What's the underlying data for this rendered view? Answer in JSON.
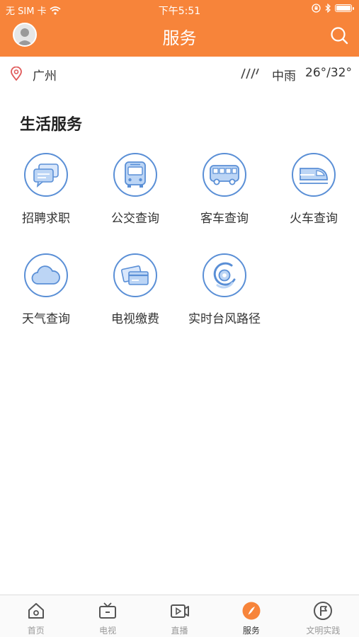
{
  "status_bar": {
    "carrier": "无 SIM 卡",
    "time": "下午5:51"
  },
  "header": {
    "title": "服务",
    "brand_color": "#f7843a"
  },
  "location_bar": {
    "city": "广州",
    "weather": "中雨",
    "temperature": "26°/32°"
  },
  "section": {
    "title": "生活服务"
  },
  "services": [
    {
      "label": "招聘求职",
      "icon": "chat-bubbles-icon"
    },
    {
      "label": "公交查询",
      "icon": "bus-icon"
    },
    {
      "label": "客车查询",
      "icon": "coach-icon"
    },
    {
      "label": "火车查询",
      "icon": "train-icon"
    },
    {
      "label": "天气查询",
      "icon": "cloud-icon"
    },
    {
      "label": "电视缴费",
      "icon": "cards-icon"
    },
    {
      "label": "实时台风路径",
      "icon": "typhoon-icon"
    }
  ],
  "tabbar": {
    "active_color": "#f7843a",
    "items": [
      {
        "label": "首页",
        "icon": "home-icon"
      },
      {
        "label": "电视",
        "icon": "tv-icon"
      },
      {
        "label": "直播",
        "icon": "live-video-icon"
      },
      {
        "label": "服务",
        "icon": "compass-icon",
        "active": true
      },
      {
        "label": "文明实践",
        "icon": "flag-icon"
      }
    ]
  }
}
